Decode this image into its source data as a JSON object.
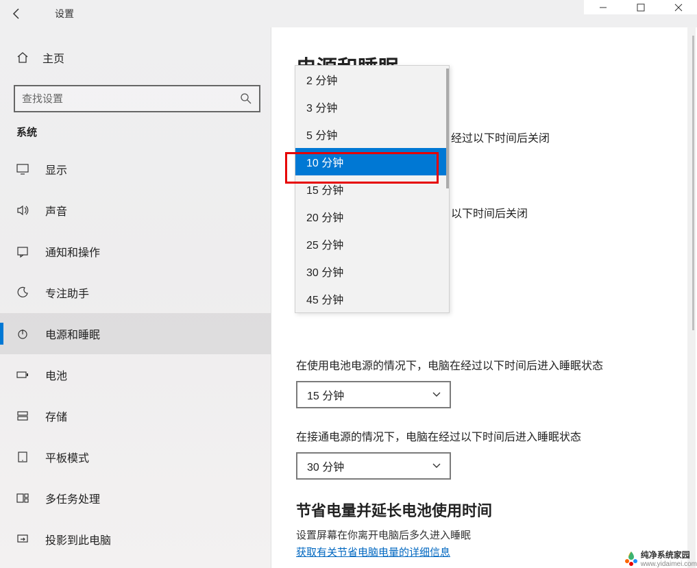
{
  "titlebar": {
    "title": "设置"
  },
  "home_label": "主页",
  "search_placeholder": "查找设置",
  "category_label": "系统",
  "nav": {
    "items": [
      {
        "label": "显示",
        "icon": "monitor-icon"
      },
      {
        "label": "声音",
        "icon": "speaker-icon"
      },
      {
        "label": "通知和操作",
        "icon": "notification-icon"
      },
      {
        "label": "专注助手",
        "icon": "moon-icon"
      },
      {
        "label": "电源和睡眠",
        "icon": "power-icon"
      },
      {
        "label": "电池",
        "icon": "battery-icon"
      },
      {
        "label": "存储",
        "icon": "storage-icon"
      },
      {
        "label": "平板模式",
        "icon": "tablet-icon"
      },
      {
        "label": "多任务处理",
        "icon": "multitask-icon"
      },
      {
        "label": "投影到此电脑",
        "icon": "project-icon"
      }
    ],
    "selected_index": 4
  },
  "content": {
    "heading": "电源和睡眠",
    "partial_text_1": "经过以下时间后关闭",
    "partial_text_2": "以下时间后关闭",
    "dropdown_options": [
      "2 分钟",
      "3 分钟",
      "5 分钟",
      "10 分钟",
      "15 分钟",
      "20 分钟",
      "25 分钟",
      "30 分钟",
      "45 分钟"
    ],
    "dropdown_selected_index": 3,
    "sleep_battery_label": "在使用电池电源的情况下，电脑在经过以下时间后进入睡眠状态",
    "sleep_battery_value": "15 分钟",
    "sleep_plugged_label": "在接通电源的情况下，电脑在经过以下时间后进入睡眠状态",
    "sleep_plugged_value": "30 分钟",
    "save_heading": "节省电量并延长电池使用时间",
    "save_body": "设置屏幕在你离开电脑后多久进入睡眠",
    "save_link": "获取有关节省电脑电量的详细信息"
  },
  "watermark": {
    "name": "纯净系统家园",
    "url": "www.yidaimei.com"
  }
}
